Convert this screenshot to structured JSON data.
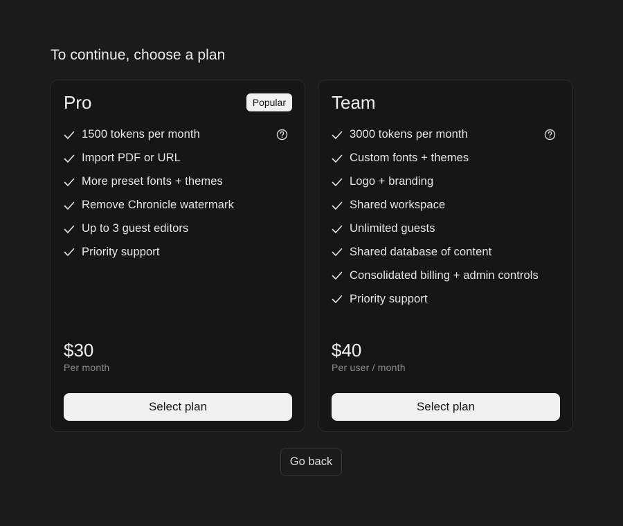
{
  "heading": "To continue, choose a plan",
  "plans": [
    {
      "name": "Pro",
      "badge": "Popular",
      "features": [
        "1500 tokens per month",
        "Import PDF or URL",
        "More preset fonts + themes",
        "Remove Chronicle watermark",
        "Up to 3 guest editors",
        "Priority support"
      ],
      "price": "$30",
      "price_sub": "Per month",
      "button_label": "Select plan"
    },
    {
      "name": "Team",
      "features": [
        "3000 tokens per month",
        "Custom fonts + themes",
        "Logo + branding",
        "Shared workspace",
        "Unlimited guests",
        "Shared database of content",
        "Consolidated billing + admin controls",
        "Priority support"
      ],
      "price": "$40",
      "price_sub": "Per user / month",
      "button_label": "Select plan"
    }
  ],
  "back_label": "Go back",
  "icons": {
    "feature": "check-icon",
    "tokens_info": "help-circle-icon"
  },
  "colors": {
    "background": "#1b1b1b",
    "card": "#161616",
    "button": "#f0f0f0",
    "muted": "#8e8e8e"
  }
}
